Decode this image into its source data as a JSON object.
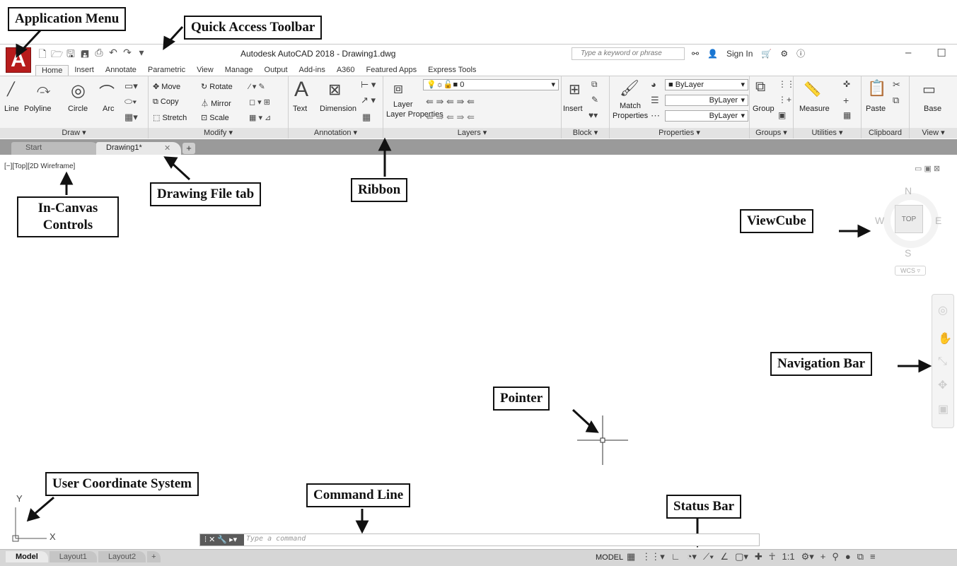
{
  "title_bar": {
    "app_title": "Autodesk AutoCAD 2018 -  Drawing1.dwg",
    "search_placeholder": "Type a keyword or phrase",
    "sign_in": "Sign In",
    "app_menu_letter": "A",
    "window_controls": [
      "–",
      "☐",
      "✕"
    ]
  },
  "ribbon_tabs": [
    "Home",
    "Insert",
    "Annotate",
    "Parametric",
    "View",
    "Manage",
    "Output",
    "Add-ins",
    "A360",
    "Featured Apps",
    "Express Tools"
  ],
  "ribbon": {
    "draw": {
      "title": "Draw ▾",
      "tools": [
        "Line",
        "Polyline",
        "Circle",
        "Arc"
      ]
    },
    "modify": {
      "title": "Modify ▾",
      "tools": [
        "Move",
        "Rotate",
        "Copy",
        "Mirror",
        "Stretch",
        "Scale"
      ]
    },
    "annotation": {
      "title": "Annotation ▾",
      "tools": [
        "Text",
        "Dimension"
      ]
    },
    "layers": {
      "title": "Layers ▾",
      "layer_properties": "Layer Properties",
      "current_layer": "0"
    },
    "block": {
      "title": "Block ▾",
      "insert": "Insert"
    },
    "properties": {
      "title": "Properties ▾",
      "match": "Match Properties",
      "color": "ByLayer",
      "linetype": "ByLayer",
      "lineweight": "ByLayer"
    },
    "groups": {
      "title": "Groups ▾",
      "group": "Group"
    },
    "utilities": {
      "title": "Utilities ▾",
      "measure": "Measure"
    },
    "clipboard": {
      "title": "Clipboard",
      "paste": "Paste"
    },
    "view": {
      "title": "View ▾",
      "base": "Base"
    }
  },
  "doc_tabs": {
    "start": "Start",
    "drawing": "Drawing1*",
    "close": "✕",
    "new": "+"
  },
  "canvas": {
    "in_canvas_controls": "[−][Top][2D Wireframe]",
    "viewcube": {
      "n": "N",
      "s": "S",
      "e": "E",
      "w": "W",
      "face": "TOP",
      "wcs": "WCS ▿"
    },
    "ucs": {
      "x": "X",
      "y": "Y"
    }
  },
  "command_line": {
    "placeholder": "Type a command"
  },
  "status_bar": {
    "layout_tabs": [
      "Model",
      "Layout1",
      "Layout2"
    ],
    "add_tab": "+",
    "model_label": "MODEL",
    "scale": "1:1"
  },
  "annotations": {
    "application_menu": "Application Menu",
    "quick_access_toolbar": "Quick Access Toolbar",
    "drawing_file_tab": "Drawing File tab",
    "ribbon": "Ribbon",
    "in_canvas_controls": "In-Canvas Controls",
    "viewcube": "ViewCube",
    "navigation_bar": "Navigation Bar",
    "pointer": "Pointer",
    "user_coordinate_system": "User Coordinate System",
    "command_line": "Command Line",
    "status_bar": "Status Bar"
  }
}
